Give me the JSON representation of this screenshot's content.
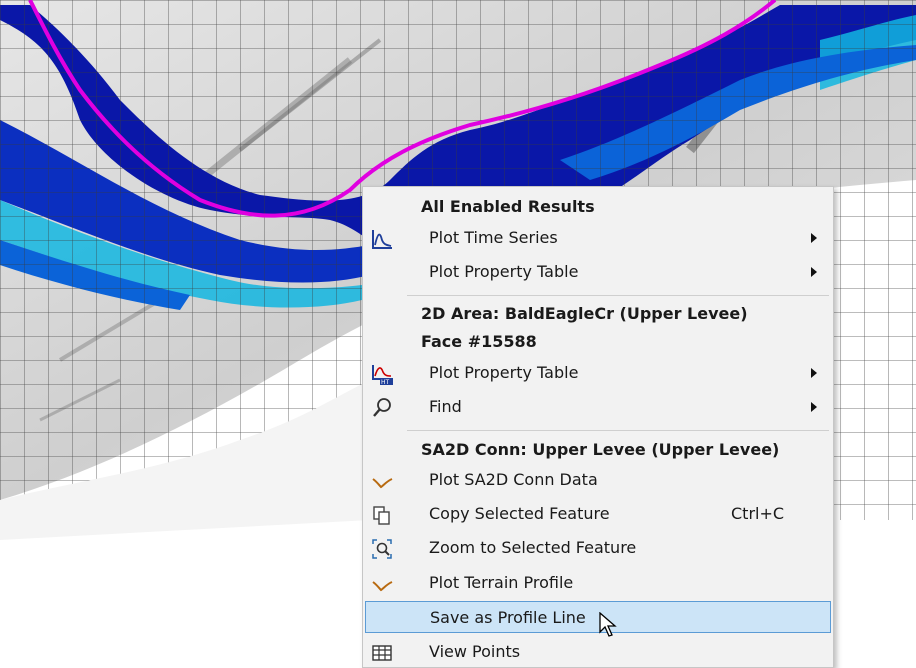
{
  "colors": {
    "deep_water": "#0a17a8",
    "mid_water": "#0b63d8",
    "shallow_water": "#12b6e0",
    "levee_line": "#e000e0",
    "terrain": "#d9d9d9",
    "grid_line": "#3a3a3a"
  },
  "menu": {
    "section1": {
      "header": "All Enabled Results",
      "items": [
        {
          "label": "Plot Time Series",
          "icon": "line-chart-icon"
        },
        {
          "label": "Plot Property Table",
          "icon": ""
        }
      ]
    },
    "section2": {
      "header_line1": "2D Area: BaldEagleCr (Upper Levee)",
      "header_line2": "Face #15588",
      "items": [
        {
          "label": "Plot Property Table",
          "icon": "hydrograph-table-icon"
        },
        {
          "label": "Find",
          "icon": "magnifier-icon"
        }
      ]
    },
    "section3": {
      "header": "SA2D Conn: Upper Levee (Upper Levee)",
      "items": [
        {
          "label": "Plot SA2D Conn Data",
          "icon": "profile-curve-icon"
        },
        {
          "label": "Copy Selected Feature",
          "shortcut": "Ctrl+C",
          "icon": "copy-icon"
        },
        {
          "label": "Zoom to Selected Feature",
          "icon": "zoom-to-feature-icon"
        },
        {
          "label": "Plot Terrain Profile",
          "icon": "profile-curve-icon"
        },
        {
          "label": "Save as Profile Line",
          "icon": "",
          "highlighted": true
        },
        {
          "label": "View Points",
          "icon": "table-grid-icon"
        }
      ]
    }
  }
}
